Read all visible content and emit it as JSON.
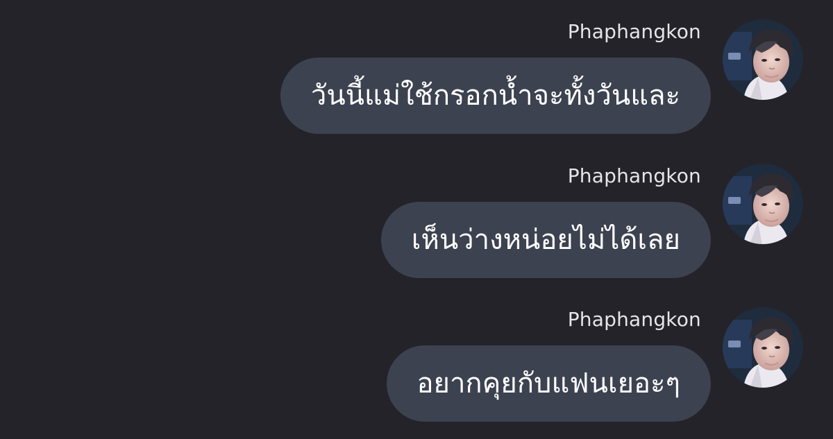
{
  "chat": {
    "messages": [
      {
        "sender": "Phaphangkon",
        "text": "วันนี้แม่ใช้กรอกน้ำจะทั้งวันและ"
      },
      {
        "sender": "Phaphangkon",
        "text": "เห็นว่างหน่อยไม่ได้เลย"
      },
      {
        "sender": "Phaphangkon",
        "text": "อยากคุยกับแฟนเยอะๆ"
      }
    ]
  },
  "colors": {
    "background": "#232329",
    "bubble": "#3d4250",
    "sender_text": "#e6e6ea",
    "message_text": "#ffffff"
  },
  "icons": {
    "avatar": "profile-photo"
  }
}
